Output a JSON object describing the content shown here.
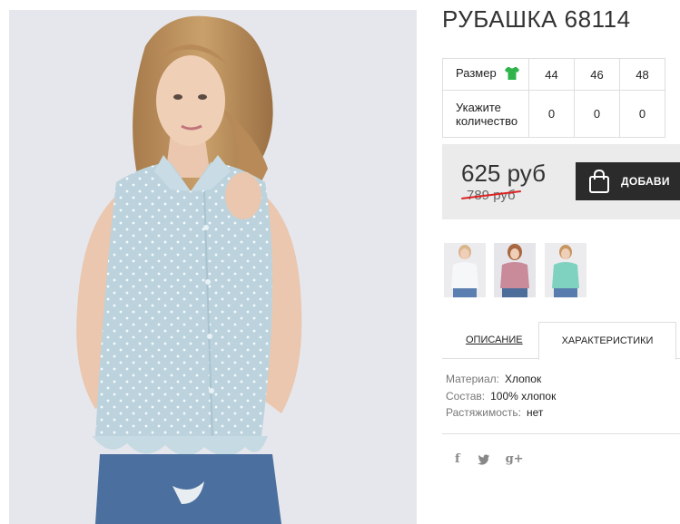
{
  "product": {
    "title": "РУБАШКА 68114"
  },
  "sizes": {
    "size_label": "Размер",
    "size_icon": "green-tshirt-icon",
    "values": [
      "44",
      "46",
      "48"
    ],
    "quantity_label": "Укажите количество",
    "quantities": [
      "0",
      "0",
      "0"
    ]
  },
  "price": {
    "current": "625 руб",
    "old": "789 руб"
  },
  "cart": {
    "button_label": "ДОБАВИ",
    "icon": "shopping-bag-icon"
  },
  "thumbnails": [
    "white-blouse-thumb",
    "pink-blouse-thumb",
    "mint-blouse-thumb"
  ],
  "tabs": {
    "description": "ОПИСАНИЕ",
    "characteristics": "ХАРАКТЕРИСТИКИ",
    "active": "characteristics"
  },
  "characteristics": [
    {
      "key": "Материал:",
      "value": "Хлопок"
    },
    {
      "key": "Состав:",
      "value": "100% хлопок"
    },
    {
      "key": "Растяжимость:",
      "value": "нет"
    }
  ],
  "social": {
    "facebook": "f",
    "twitter": "twitter-bird",
    "googleplus": "g+"
  },
  "colors": {
    "accent_green": "#2fb34a",
    "button_dark": "#2b2b2b",
    "old_price_strike": "#dd2222",
    "price_bg": "#ebebeb"
  }
}
